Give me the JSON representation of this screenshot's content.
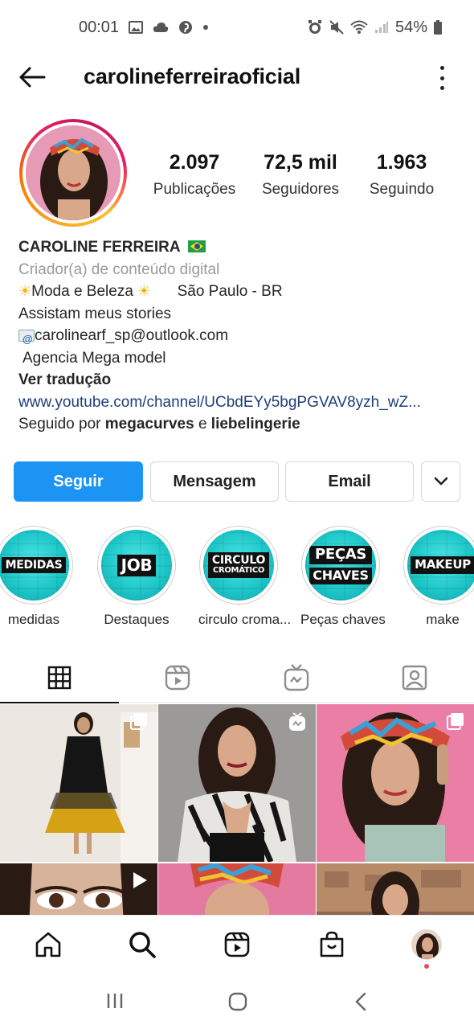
{
  "status_bar": {
    "time": "00:01",
    "battery": "54%"
  },
  "header": {
    "username": "carolineferreiraoficial"
  },
  "stats": [
    {
      "value": "2.097",
      "label": "Publicações"
    },
    {
      "value": "72,5 mil",
      "label": "Seguidores"
    },
    {
      "value": "1.963",
      "label": "Seguindo"
    }
  ],
  "bio": {
    "name": "CAROLINE FERREIRA",
    "category": "Criador(a) de conteúdo digital",
    "line1_a": "Moda e Beleza",
    "line1_b": "São Paulo - BR",
    "line2": "Assistam meus stories",
    "email": "carolinearf_sp@outlook.com",
    "agency": "Agencia Mega model",
    "translate": "Ver tradução",
    "link": "www.youtube.com/channel/UCbdEYy5bgPGVAV8yzh_wZ...",
    "followed_prefix": "Seguido por",
    "followed_user1": "megacurves",
    "followed_and": "e",
    "followed_user2": "liebelingerie"
  },
  "buttons": {
    "follow": "Seguir",
    "message": "Mensagem",
    "email": "Email"
  },
  "highlights": [
    {
      "tag": "MEDIDAS",
      "label": "medidas"
    },
    {
      "tag": "JOB",
      "label": "Destaques"
    },
    {
      "tag_line1": "CIRCULO",
      "tag_line2": "CROMÁTICO",
      "label": "circulo croma..."
    },
    {
      "tag_line1": "PEÇAS",
      "tag_line2": "CHAVES",
      "label": "Peças chaves"
    },
    {
      "tag": "MAKEUP",
      "label": "make"
    }
  ],
  "tabs": [
    {
      "icon": "grid-icon",
      "active": true
    },
    {
      "icon": "reels-icon",
      "active": false
    },
    {
      "icon": "igtv-icon",
      "active": false
    },
    {
      "icon": "tagged-icon",
      "active": false
    }
  ],
  "bottom_nav": [
    "home-icon",
    "search-icon",
    "reels-icon",
    "shop-icon",
    "profile-avatar"
  ],
  "colors": {
    "follow_button": "#1c94f4",
    "link": "#1d3e7a",
    "highlight_teal": "#1fc7c9",
    "notification_dot": "#ed4956"
  }
}
